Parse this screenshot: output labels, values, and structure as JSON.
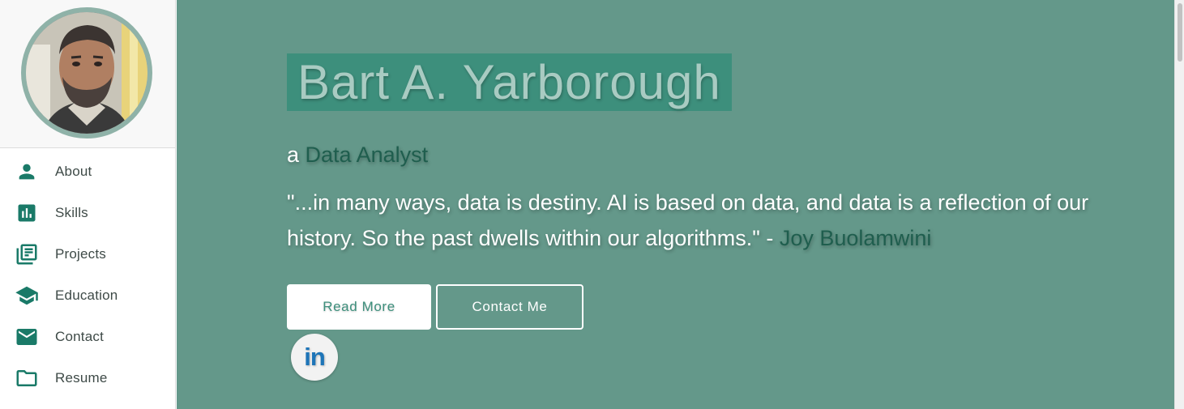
{
  "sidebar": {
    "items": [
      {
        "label": "About",
        "icon": "person-icon"
      },
      {
        "label": "Skills",
        "icon": "bar-chart-icon"
      },
      {
        "label": "Projects",
        "icon": "library-books-icon"
      },
      {
        "label": "Education",
        "icon": "graduation-cap-icon"
      },
      {
        "label": "Contact",
        "icon": "envelope-icon"
      },
      {
        "label": "Resume",
        "icon": "folder-icon"
      }
    ]
  },
  "hero": {
    "name": "Bart A. Yarborough",
    "role_prefix": "a ",
    "role": "Data Analyst",
    "quote": "\"...in many ways, data is destiny. AI is based on data, and data is a reflection of our history. So the past dwells within our algorithms.\" - ",
    "quote_author": "Joy Buolamwini",
    "read_more_label": "Read More",
    "contact_label": "Contact Me",
    "social_text": "in"
  },
  "colors": {
    "accent": "#1a7a68",
    "hero_background": "#64988a",
    "name_highlight": "#3d8f7c",
    "linkedin_blue": "#1e75b8"
  }
}
